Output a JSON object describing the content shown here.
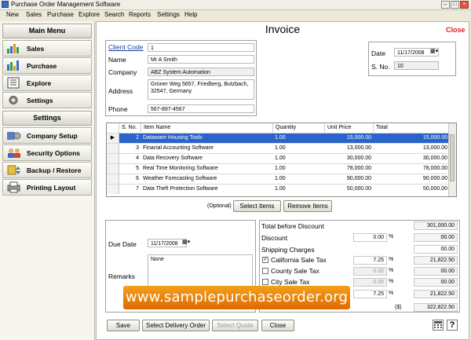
{
  "window": {
    "title": "Purchase Order Management Software"
  },
  "menu": [
    "New",
    "Sales",
    "Purchase",
    "Explore",
    "Search",
    "Reports",
    "Settings",
    "Help"
  ],
  "sidebar": {
    "main_heading": "Main Menu",
    "main_items": [
      {
        "label": "Sales",
        "icon": "sales-chart-icon"
      },
      {
        "label": "Purchase",
        "icon": "purchase-chart-icon"
      },
      {
        "label": "Explore",
        "icon": "explore-list-icon"
      },
      {
        "label": "Settings",
        "icon": "settings-gear-icon"
      }
    ],
    "settings_heading": "Settings",
    "settings_items": [
      {
        "label": "Company Setup",
        "icon": "company-setup-icon"
      },
      {
        "label": "Security Options",
        "icon": "security-users-icon"
      },
      {
        "label": "Backup / Restore",
        "icon": "backup-restore-icon"
      },
      {
        "label": "Printing Layout",
        "icon": "printing-layout-icon"
      }
    ]
  },
  "invoice": {
    "title": "Invoice",
    "close_label": "Close",
    "client_code_label": "Client Code",
    "client_code": "1",
    "name_label": "Name",
    "name": "Mr A Smith",
    "company_label": "Company",
    "company": "ABZ System Automation",
    "address_label": "Address",
    "address": "Grüner Weg 5657, Friedberg, Butzbach, 32547, Germany",
    "phone_label": "Phone",
    "phone": "567-897-4567",
    "date_label": "Date",
    "date": "11/17/2008",
    "sno_label": "S. No.",
    "sno": "10"
  },
  "items_table": {
    "columns": [
      "S. No.",
      "Item Name",
      "Quantity",
      "Unit Price",
      "Total"
    ],
    "rows": [
      {
        "sno": "2",
        "name": "Dataware Housing Tools",
        "qty": "1.00",
        "price": "15,000.00",
        "total": "15,000.00"
      },
      {
        "sno": "3",
        "name": "Finacial Accounting Software",
        "qty": "1.00",
        "price": "13,000.00",
        "total": "13,000.00"
      },
      {
        "sno": "4",
        "name": "Data Recovery Software",
        "qty": "1.00",
        "price": "30,000.00",
        "total": "30,000.00"
      },
      {
        "sno": "5",
        "name": "Real Time Monitoring Software",
        "qty": "1.00",
        "price": "78,000.00",
        "total": "78,000.00"
      },
      {
        "sno": "6",
        "name": "Weather Forecasting Software",
        "qty": "1.00",
        "price": "90,000.00",
        "total": "90,000.00"
      },
      {
        "sno": "7",
        "name": "Data Theft Protection Software",
        "qty": "1.00",
        "price": "50,000.00",
        "total": "50,000.00"
      }
    ],
    "optional_label": "(Optional)",
    "select_items": "Select Items",
    "remove_items": "Remove Items"
  },
  "details": {
    "due_date_label": "Due Date",
    "due_date": "11/17/2008",
    "remarks_label": "Remarks",
    "remarks": "None"
  },
  "totals": {
    "total_before_discount_label": "Total before Discount",
    "total_before_discount": "301,000.00",
    "discount_label": "Discount",
    "discount_pct": "0.00",
    "discount": "00.00",
    "shipping_label": "Shipping Charges",
    "shipping": "00.00",
    "california_label": "California Sale Tax",
    "california_pct": "7.25",
    "california": "21,822.50",
    "county_label": "County Sale Tax",
    "county_pct": "0.00",
    "county": "00.00",
    "city_label": "City Sale Tax",
    "city_pct": "0.00",
    "city": "00.00",
    "extra_pct": "7.25",
    "extra": "21,822.50",
    "grand_currency": "($)",
    "grand_total": "322,822.50",
    "pct_symbol": "%"
  },
  "footer": {
    "save": "Save",
    "select_delivery_order": "Select Delivery Order",
    "select_quote": "Select Quote",
    "close": "Close"
  },
  "banner": "www.samplepurchaseorder.org",
  "colors": {
    "selected_row": "#2a63c9",
    "close_link": "#e02020",
    "banner": "#ee8a0c"
  }
}
